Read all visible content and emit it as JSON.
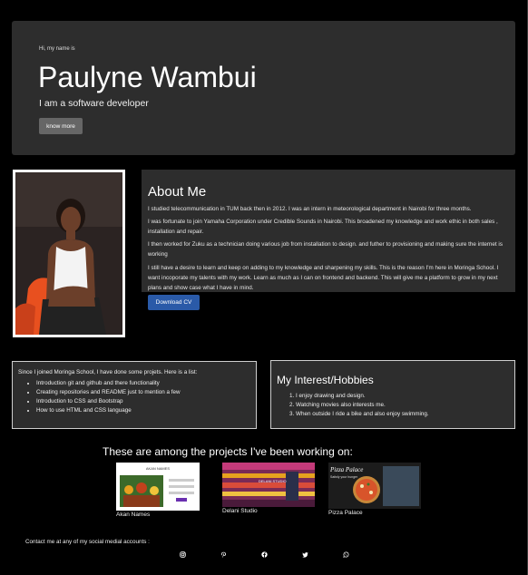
{
  "hero": {
    "greeting": "Hi, my name is",
    "name": "Paulyne Wambui",
    "role": "I am a software developer",
    "button": "know more"
  },
  "about": {
    "title": "About Me",
    "paragraphs": [
      "I studied telecommunication in TUM back then in 2012. I was an intern in meteorological department in Nairobi for three months.",
      "I was fortunate to join Yamaha Corporation under Credible Sounds in Nairobi. This broadened my knowledge and work ethic in both sales , installation and repair.",
      "I then worked for Zuku as a technician doing various job from installation to design. and futher to provisioning and making sure the internet is working",
      "I still have a desire to learn and keep on adding to my knowledge and sharpening my skills. This is the reason I'm here in Moringa School. I want incoporate my talents with my work. Learn as much as I can on frontend and backend. This will give me a platform to grow in my next plans and show case what I have in mind."
    ],
    "cv_button": "Download CV"
  },
  "moringa": {
    "intro": "Since I joined Moringa School, I have done some projets. Here is a list:",
    "items": [
      "Introduction git and github and there functionality",
      "Creating repositories and README just to mention a few",
      "Introduction to CSS and Bootstrap",
      "How to use HTML and CSS language"
    ]
  },
  "interests": {
    "title": "My Interest/Hobbies",
    "items": [
      "I enjoy drawing and design.",
      "Watching movies also interests me.",
      "When outside I ride a bike and also enjoy swimming."
    ]
  },
  "projects": {
    "title": "These are among the projects I've been working on:",
    "items": [
      {
        "caption": "Akan Names",
        "thumb_title": "AKAN NAMES"
      },
      {
        "caption": "Delani Studio",
        "thumb_title": "DELANI STUDIO"
      },
      {
        "caption": "Pizza Palace",
        "thumb_title": "Pizza Palace",
        "thumb_sub": "Satisfy your hunger"
      }
    ]
  },
  "contact": {
    "text": "Contact me at any of my social medial accounts :",
    "icons": [
      "instagram-icon",
      "pinterest-icon",
      "facebook-icon",
      "twitter-icon",
      "whatsapp-icon"
    ]
  },
  "colors": {
    "background": "#000000",
    "panel": "#2d2d2d",
    "primary_button": "#2a5aa8",
    "secondary_button": "#666666"
  }
}
